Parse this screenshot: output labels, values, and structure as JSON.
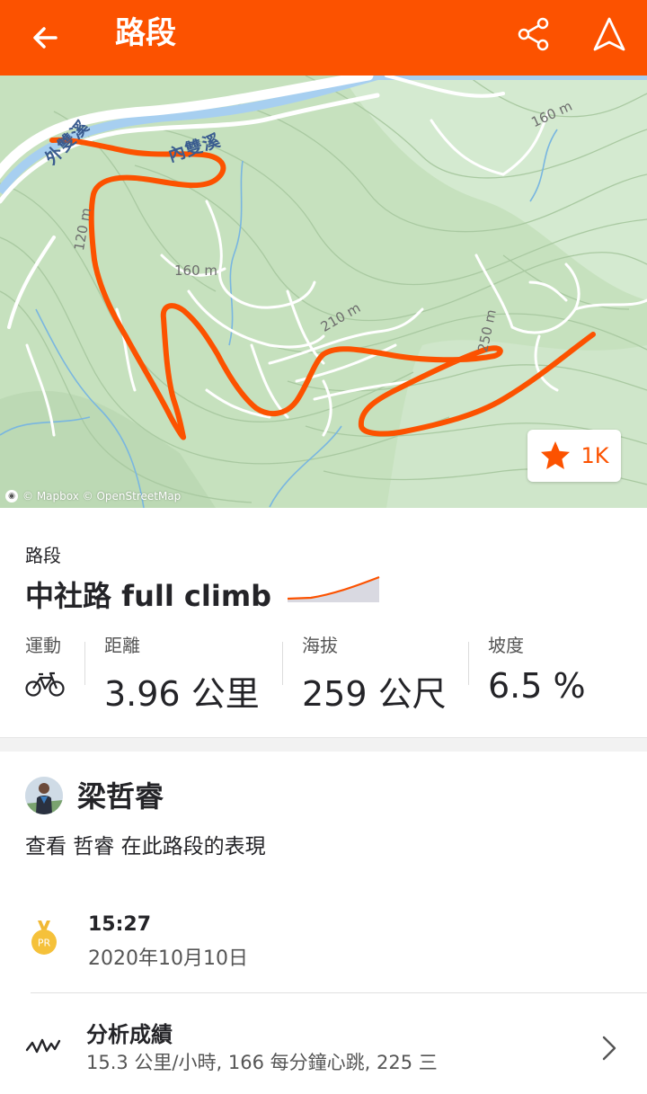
{
  "header": {
    "title": "路段",
    "background": "#fc5200"
  },
  "map": {
    "labels": {
      "water1": "外雙溪",
      "water2": "內雙溪",
      "c160a": "160 m",
      "c120": "120 m",
      "c160b": "160 m",
      "c210": "210 m",
      "c250": "250 m"
    },
    "attribution": "© Mapbox © OpenStreetMap",
    "star_count": "1K",
    "route_color": "#fc5200"
  },
  "segment": {
    "kind_label": "路段",
    "name": "中社路 full climb",
    "stats": {
      "sport_label": "運動",
      "distance_label": "距離",
      "distance_value": "3.96 公里",
      "elevation_label": "海拔",
      "elevation_value": "259 公尺",
      "grade_label": "坡度",
      "grade_value": "6.5 %"
    }
  },
  "athlete": {
    "name": "梁哲睿",
    "view_text": "查看 哲睿 在此路段的表現",
    "pr": {
      "badge": "PR",
      "time": "15:27",
      "date": "2020年10月10日"
    },
    "analysis": {
      "title": "分析成績",
      "summary": "15.3 公里/小時, 166 每分鐘心跳, 225 三"
    }
  }
}
